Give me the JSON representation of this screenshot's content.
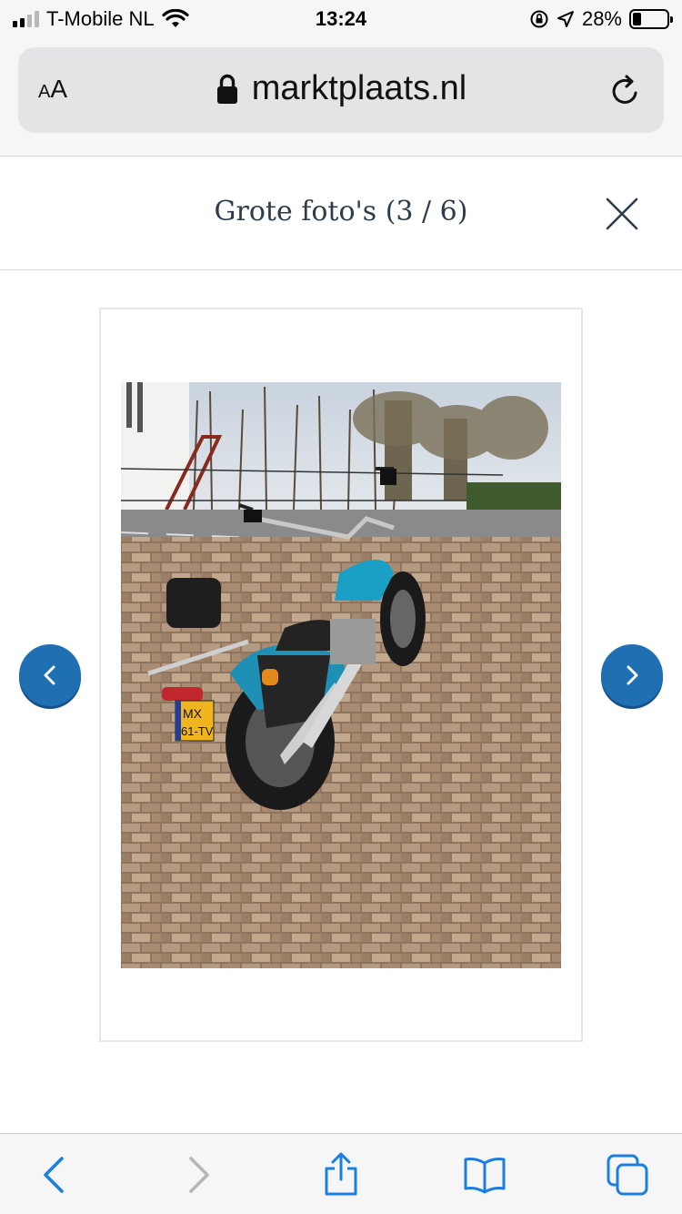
{
  "status_bar": {
    "carrier": "T-Mobile NL",
    "time": "13:24",
    "battery_percent": "28%",
    "signal_bars_active": 2,
    "signal_bars_total": 4
  },
  "address_bar": {
    "text_size_label": "AA",
    "url": "marktplaats.nl"
  },
  "gallery": {
    "title": "Grote foto's (3 / 6)"
  },
  "photo": {
    "license_plate_line1": "MX",
    "license_plate_line2": "61-TV",
    "description_icon": "motorcycle-photo"
  },
  "colors": {
    "accent_blue": "#1f6fb3",
    "toolbar_blue": "#1a7fe0",
    "title_color": "#2d3c4c"
  },
  "toolbar": {
    "icons": [
      "back-icon",
      "forward-icon",
      "share-icon",
      "bookmarks-icon",
      "tabs-icon"
    ]
  }
}
